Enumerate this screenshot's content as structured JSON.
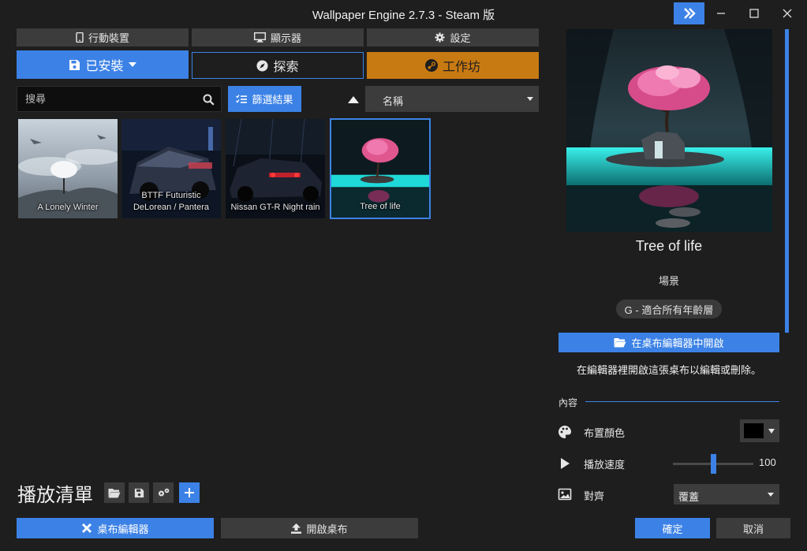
{
  "app": {
    "title": "Wallpaper Engine 2.7.3 - Steam 版"
  },
  "top_buttons": {
    "mobile": "行動裝置",
    "display": "顯示器",
    "settings": "設定"
  },
  "tabs": {
    "installed": "已安裝",
    "discover": "探索",
    "workshop": "工作坊"
  },
  "search": {
    "placeholder": "搜尋"
  },
  "filter": {
    "label": "篩選結果"
  },
  "sort": {
    "selected": "名稱"
  },
  "wallpapers": [
    {
      "title": "A Lonely Winter"
    },
    {
      "title": "BTTF Futuristic DeLorean / Pantera"
    },
    {
      "title": "Nissan GT-R Night rain"
    },
    {
      "title": "Tree of life"
    }
  ],
  "playlist": {
    "label": "播放清單"
  },
  "bottom": {
    "editor": "桌布編輯器",
    "open": "開啟桌布"
  },
  "detail": {
    "title": "Tree of life",
    "type": "場景",
    "rating": "G - 適合所有年齡層",
    "open_in_editor": "在桌布編輯器中開啟",
    "editor_hint": "在編輯器裡開啟這張桌布以編輯或刪除。"
  },
  "properties": {
    "section": "內容",
    "scheme_color": {
      "label": "布置顏色",
      "value": "#000000"
    },
    "playback_speed": {
      "label": "播放速度",
      "value": "100",
      "level": 0.5
    },
    "alignment": {
      "label": "對齊",
      "value": "覆蓋"
    }
  },
  "dialog": {
    "ok": "確定",
    "cancel": "取消"
  },
  "colors": {
    "accent": "#3c82e6",
    "workshop": "#c87a12",
    "background": "#1e1e1e",
    "button": "#3c3c3c"
  }
}
